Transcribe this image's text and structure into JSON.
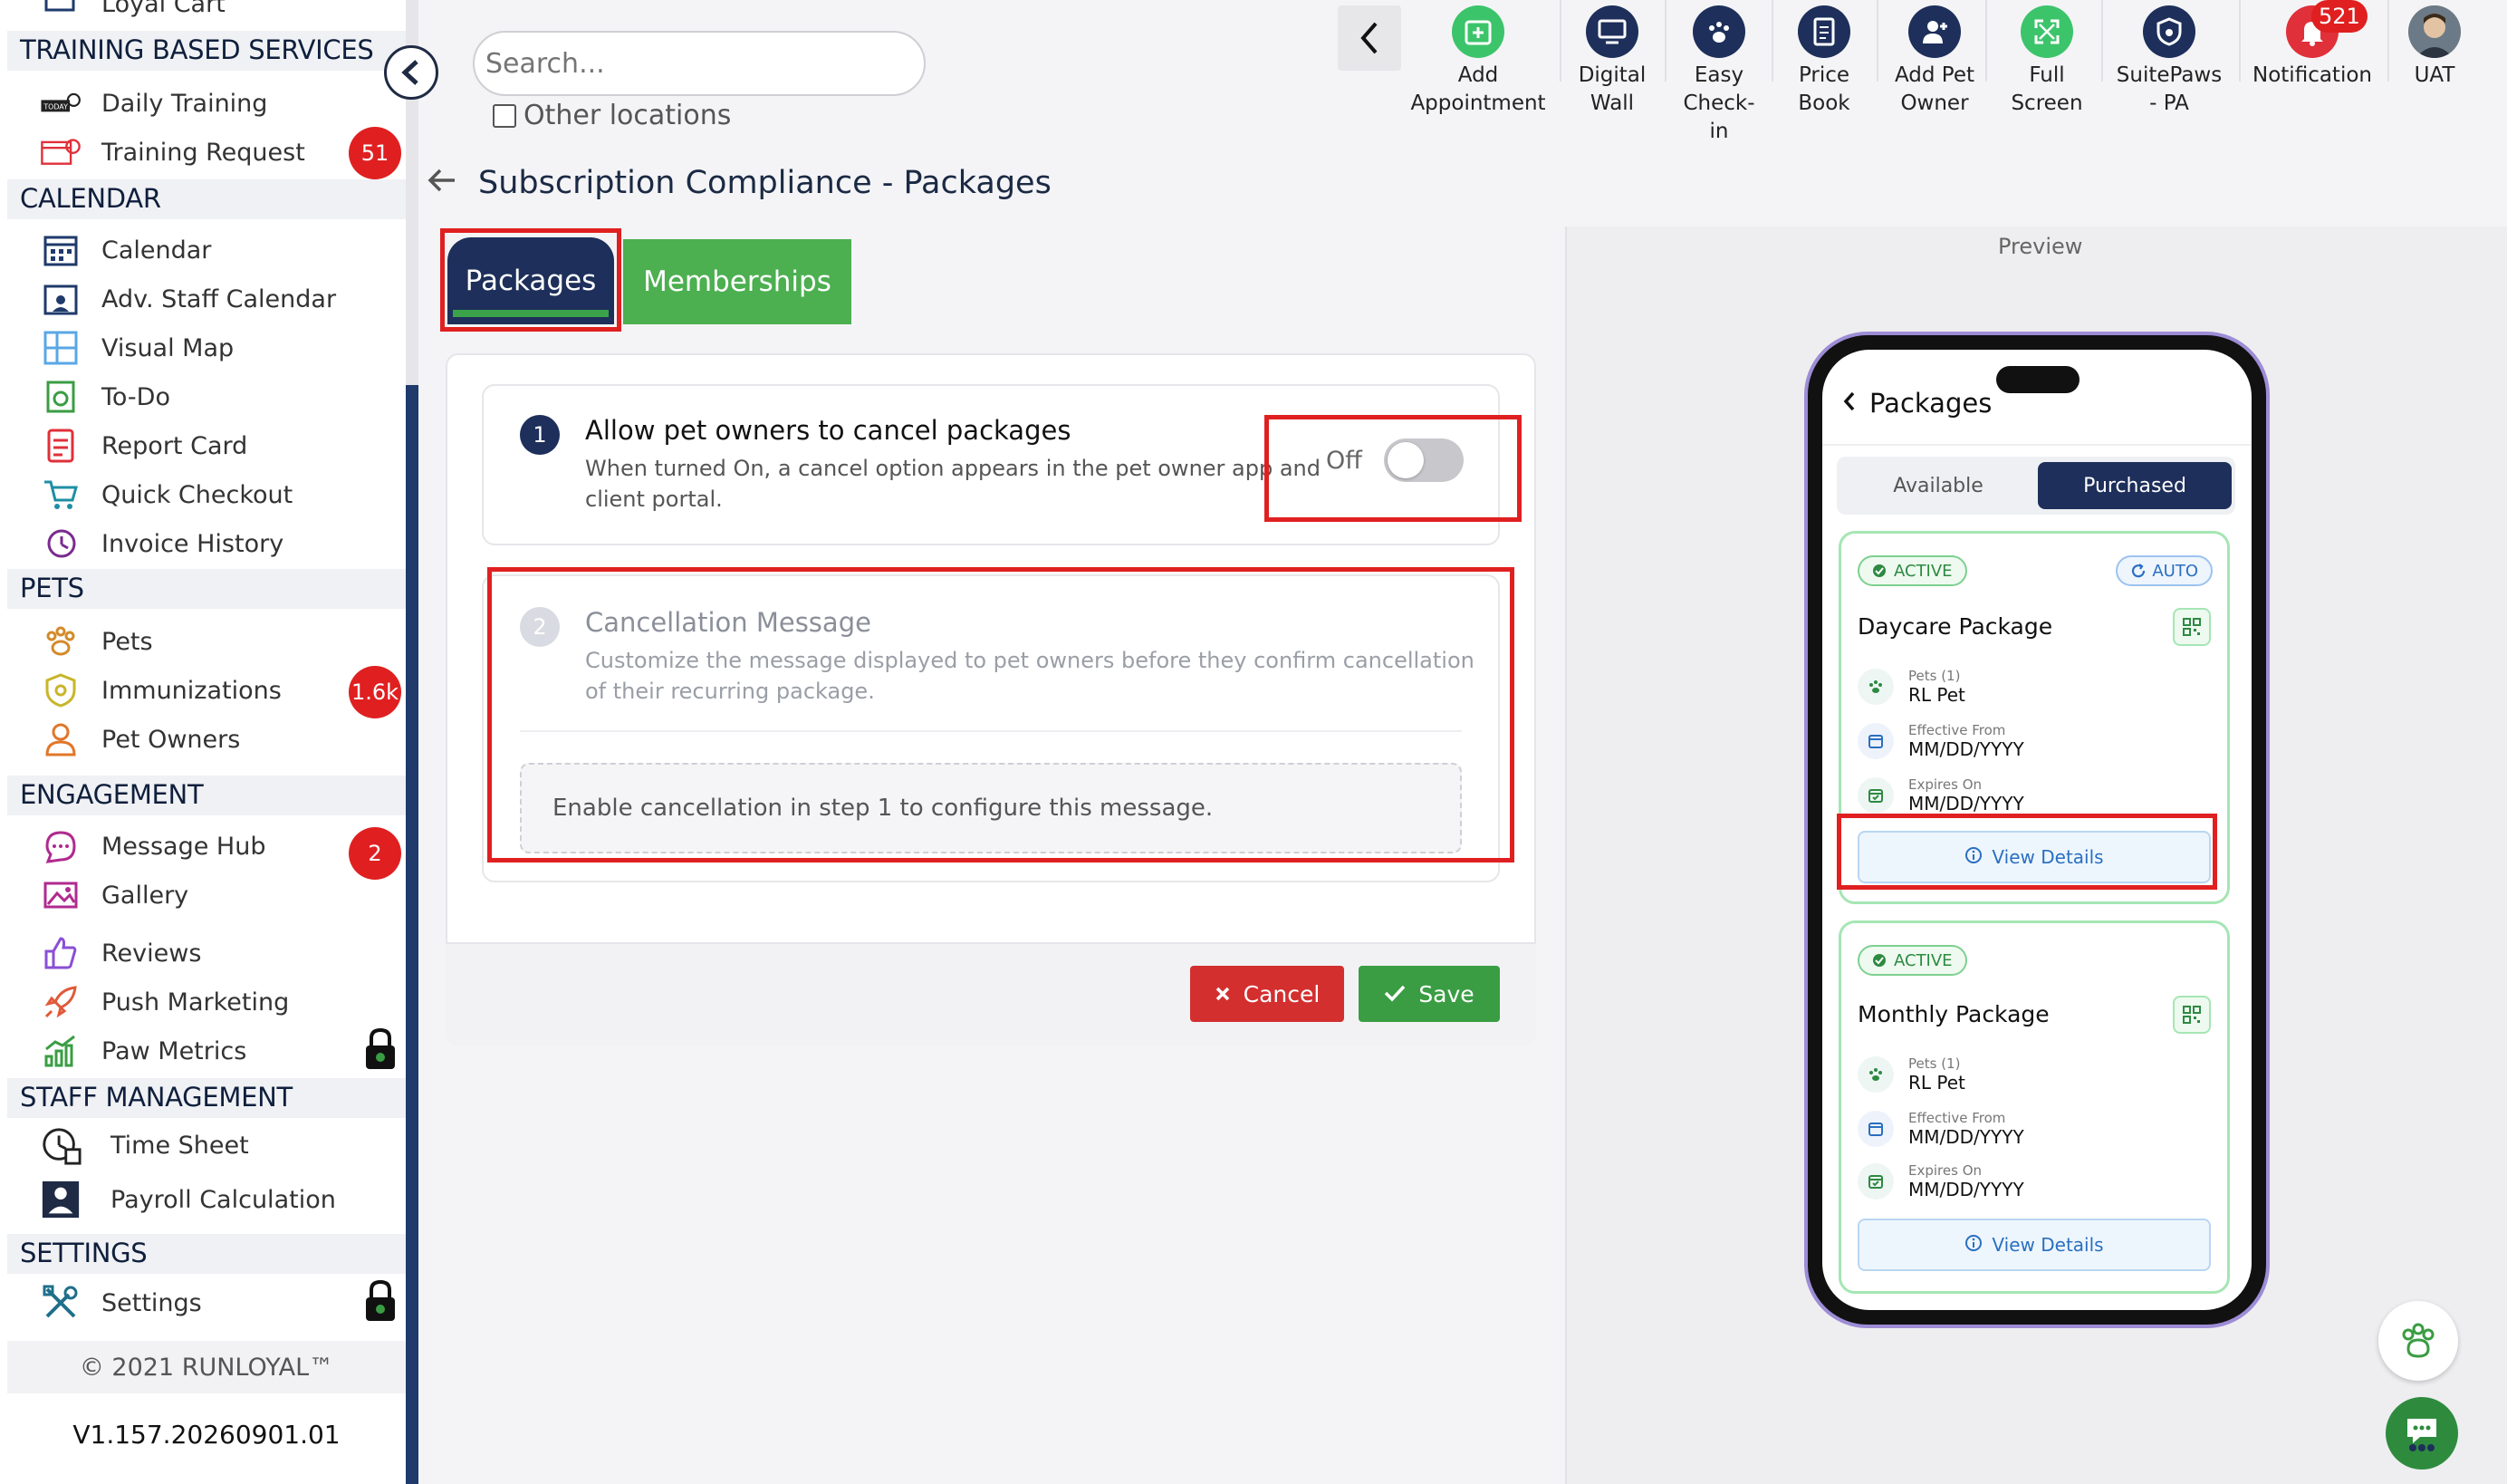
{
  "sidebar": {
    "top_partial": "Loyal Cart",
    "sections": {
      "training": "TRAINING BASED SERVICES",
      "calendar": "CALENDAR",
      "pets": "PETS",
      "engagement": "ENGAGEMENT",
      "staff": "STAFF MANAGEMENT",
      "settings": "SETTINGS"
    },
    "items": {
      "daily_training": "Daily Training",
      "training_request": "Training Request",
      "calendar": "Calendar",
      "adv_staff_calendar": "Adv. Staff Calendar",
      "visual_map": "Visual Map",
      "todo": "To-Do",
      "report_card": "Report Card",
      "quick_checkout": "Quick Checkout",
      "invoice_history": "Invoice History",
      "pets": "Pets",
      "immunizations": "Immunizations",
      "pet_owners": "Pet Owners",
      "message_hub": "Message Hub",
      "gallery": "Gallery",
      "reviews": "Reviews",
      "push_marketing": "Push Marketing",
      "paw_metrics": "Paw Metrics",
      "time_sheet": "Time Sheet",
      "payroll_calculation": "Payroll Calculation",
      "settings": "Settings"
    },
    "badges": {
      "training_request": "51",
      "immunizations": "1.6k",
      "message_hub": "2"
    },
    "copyright": "© 2021  RUNLOYAL™",
    "version": "V1.157.20260901.01"
  },
  "topbar": {
    "search_placeholder": "Search...",
    "other_locations": "Other locations",
    "items": {
      "add_appointment_1": "Add",
      "add_appointment_2": "Appointment",
      "digital_wall_1": "Digital",
      "digital_wall_2": "Wall",
      "easy_checkin_1": "Easy",
      "easy_checkin_2": "Check-",
      "easy_checkin_3": "in",
      "price_book_1": "Price",
      "price_book_2": "Book",
      "add_pet_owner_1": "Add Pet",
      "add_pet_owner_2": "Owner",
      "full_screen_1": "Full",
      "full_screen_2": "Screen",
      "suitepaws_1": "SuitePaws",
      "suitepaws_2": "- PA",
      "notification": "Notification",
      "uat": "UAT"
    },
    "notification_count": "521"
  },
  "page": {
    "title": "Subscription Compliance - Packages",
    "tabs": {
      "packages": "Packages",
      "memberships": "Memberships"
    },
    "step1": {
      "num": "1",
      "title": "Allow pet owners to cancel packages",
      "desc_1": "When turned On, a cancel option appears in the pet owner app and",
      "desc_2": "client portal.",
      "toggle_label": "Off"
    },
    "step2": {
      "num": "2",
      "title": "Cancellation Message",
      "desc_1": "Customize the message displayed to pet owners before they confirm cancellation",
      "desc_2": "of their recurring package.",
      "disabled_msg": "Enable cancellation in step 1 to configure this message."
    },
    "buttons": {
      "cancel": "Cancel",
      "save": "Save"
    }
  },
  "preview": {
    "label": "Preview",
    "header": "Packages",
    "segments": {
      "available": "Available",
      "purchased": "Purchased"
    },
    "packages": [
      {
        "status": "ACTIVE",
        "auto": "AUTO",
        "name": "Daycare Package",
        "pets_label": "Pets (1)",
        "pets_value": "RL Pet",
        "eff_label": "Effective From",
        "eff_value": "MM/DD/YYYY",
        "exp_label": "Expires On",
        "exp_value": "MM/DD/YYYY",
        "view": "View Details"
      },
      {
        "status": "ACTIVE",
        "name": "Monthly Package",
        "pets_label": "Pets (1)",
        "pets_value": "RL Pet",
        "eff_label": "Effective From",
        "eff_value": "MM/DD/YYYY",
        "exp_label": "Expires On",
        "exp_value": "MM/DD/YYYY",
        "view": "View Details"
      }
    ]
  },
  "colors": {
    "navy": "#1d2f5a",
    "green": "#4caf50",
    "red": "#e02020",
    "highlight": "#e02020"
  }
}
